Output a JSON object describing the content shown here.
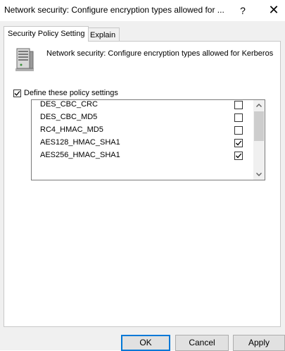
{
  "window": {
    "title": "Network security: Configure encryption types allowed for ...",
    "help_label": "?",
    "close_label": "✕"
  },
  "tabs": [
    {
      "label": "Security Policy Setting",
      "active": true
    },
    {
      "label": "Explain",
      "active": false
    }
  ],
  "policy": {
    "icon": "server-icon",
    "description": "Network security: Configure encryption types allowed for Kerberos"
  },
  "define": {
    "label": "Define these policy settings",
    "checked": true
  },
  "encryption_types": [
    {
      "label": "DES_CBC_CRC",
      "checked": false
    },
    {
      "label": "DES_CBC_MD5",
      "checked": false
    },
    {
      "label": "RC4_HMAC_MD5",
      "checked": false
    },
    {
      "label": "AES128_HMAC_SHA1",
      "checked": true
    },
    {
      "label": "AES256_HMAC_SHA1",
      "checked": true
    }
  ],
  "buttons": {
    "ok": "OK",
    "cancel": "Cancel",
    "apply": "Apply"
  }
}
